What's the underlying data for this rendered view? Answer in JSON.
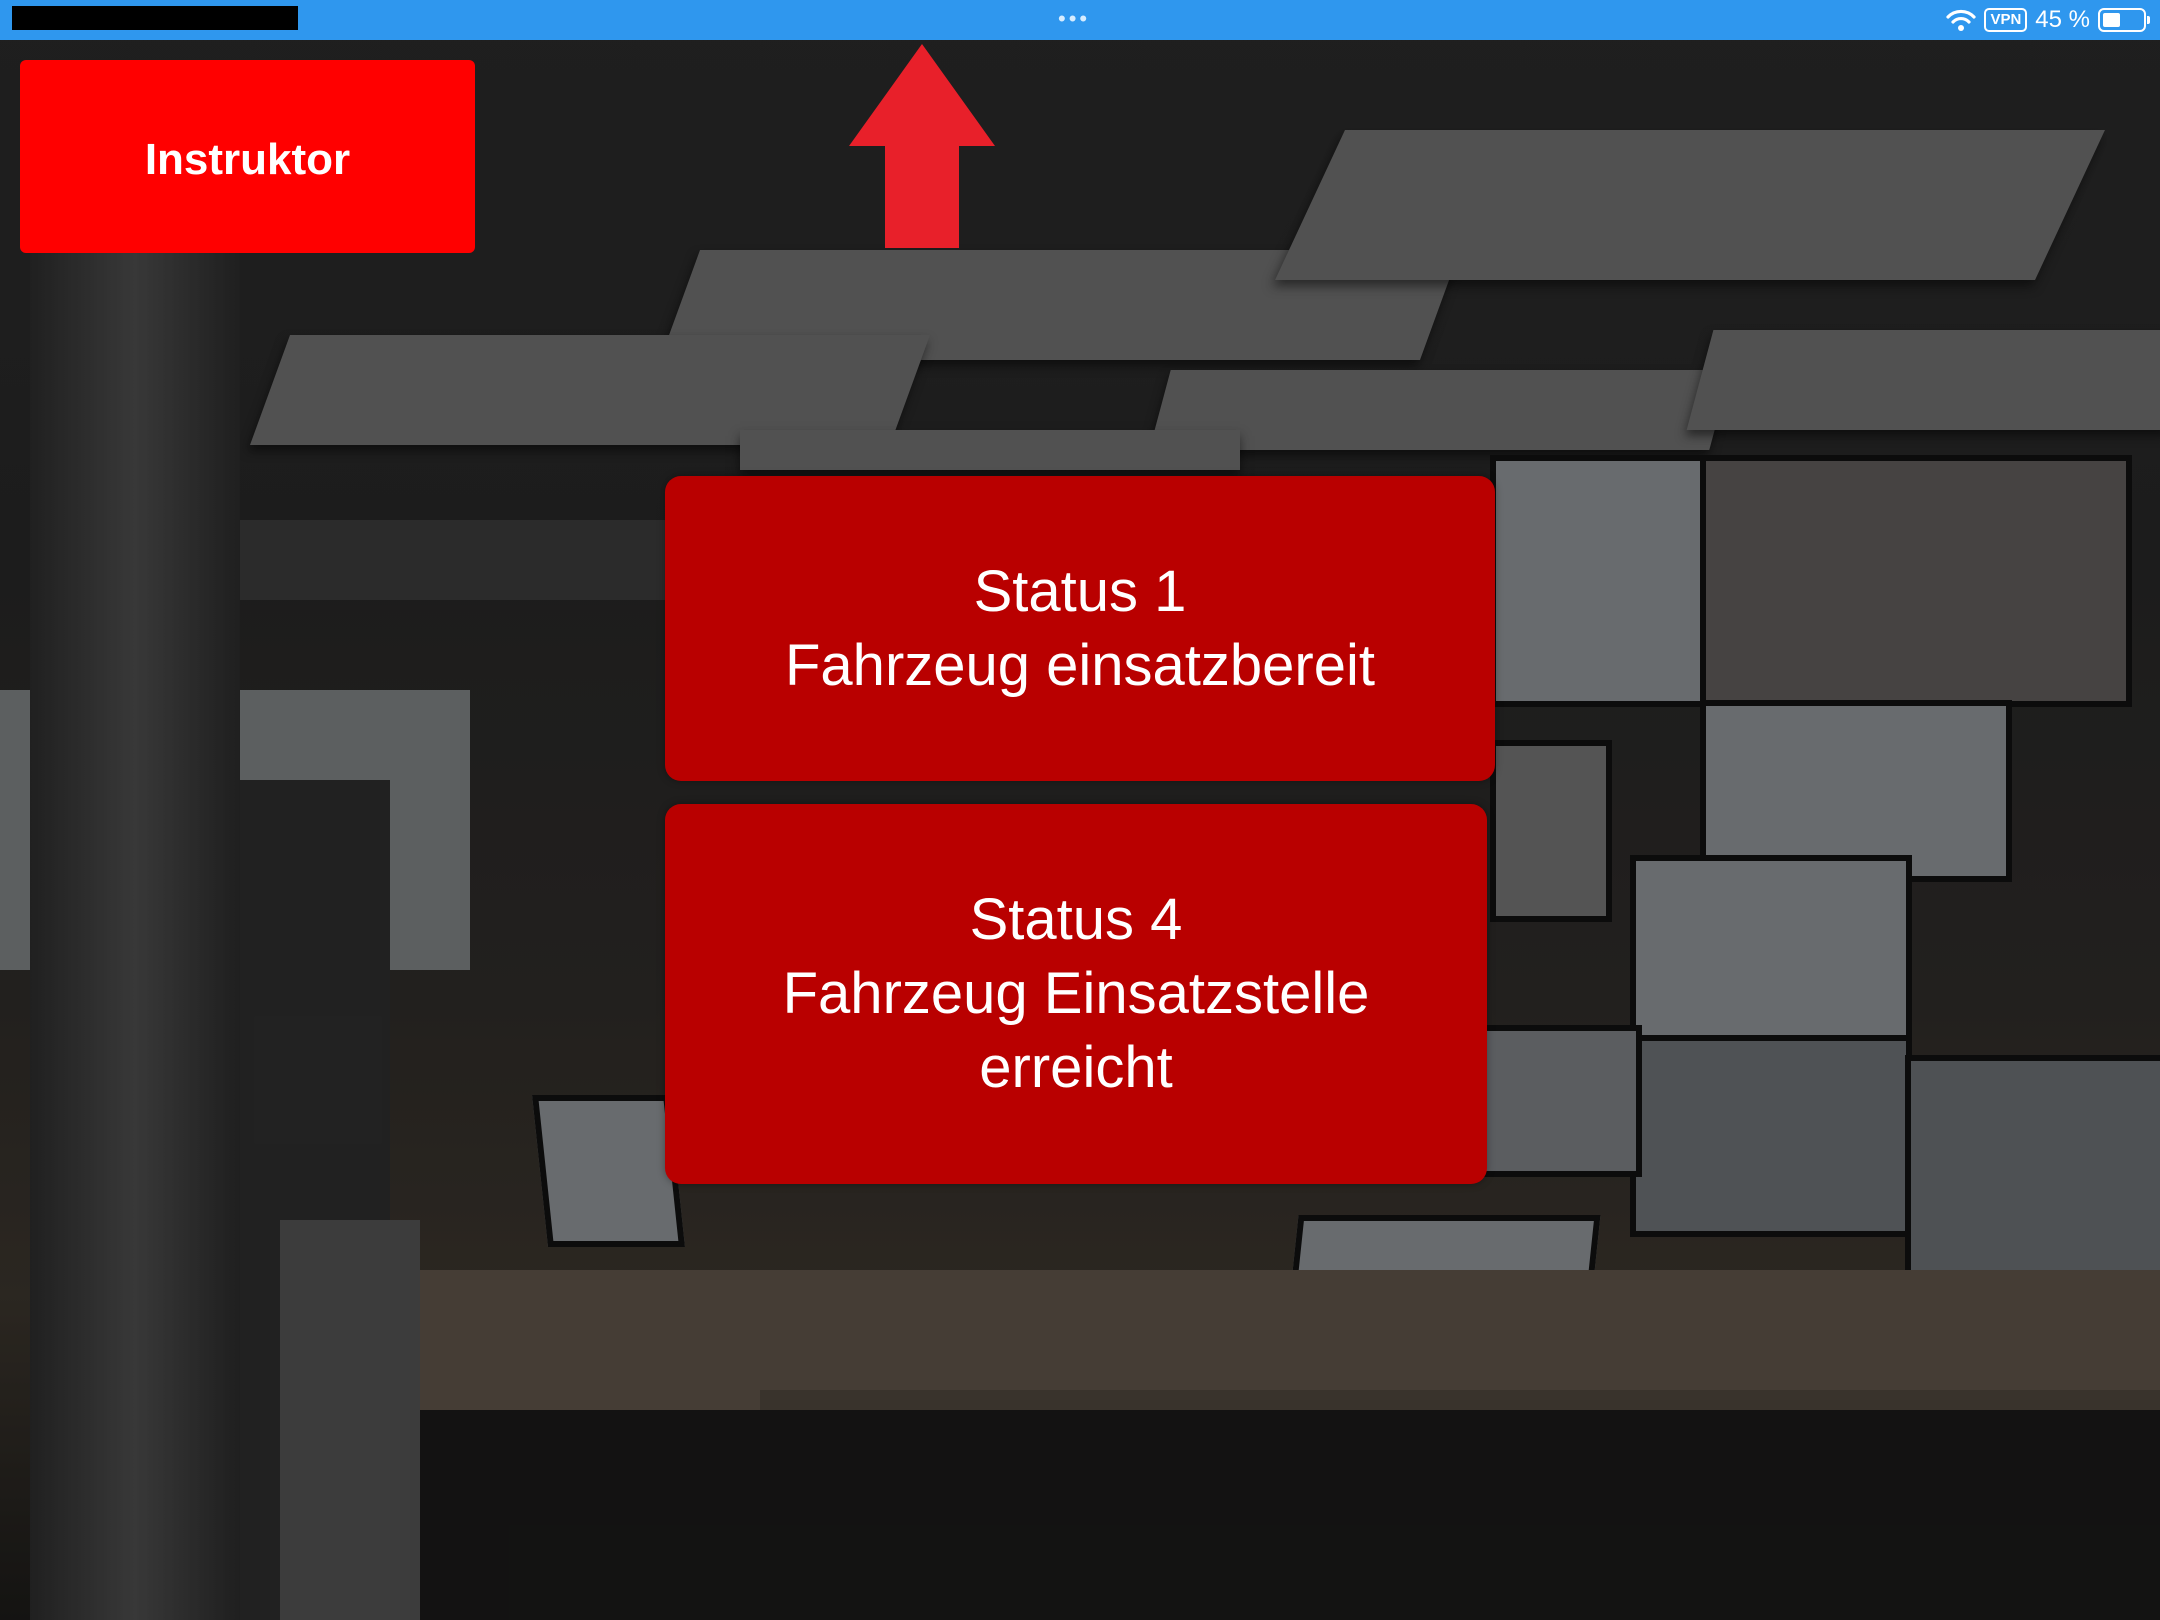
{
  "status_bar": {
    "dots": "•••",
    "vpn": "VPN",
    "battery_text": "45 %",
    "battery_level": 0.45
  },
  "instruktor_button": {
    "label": "Instruktor"
  },
  "status_buttons": [
    {
      "line1": "Status 1",
      "line2": "Fahrzeug einsatzbereit"
    },
    {
      "line1": "Status 4",
      "line2": "Fahrzeug Einsatzstelle",
      "line3": "erreicht"
    }
  ],
  "colors": {
    "status_bar": "#2f97ee",
    "instruktor": "#ff0000",
    "status_button": "#b90000",
    "arrow": "#e8202a"
  },
  "icons": [
    "wifi-icon",
    "vpn-badge",
    "battery-icon",
    "up-arrow-icon"
  ]
}
